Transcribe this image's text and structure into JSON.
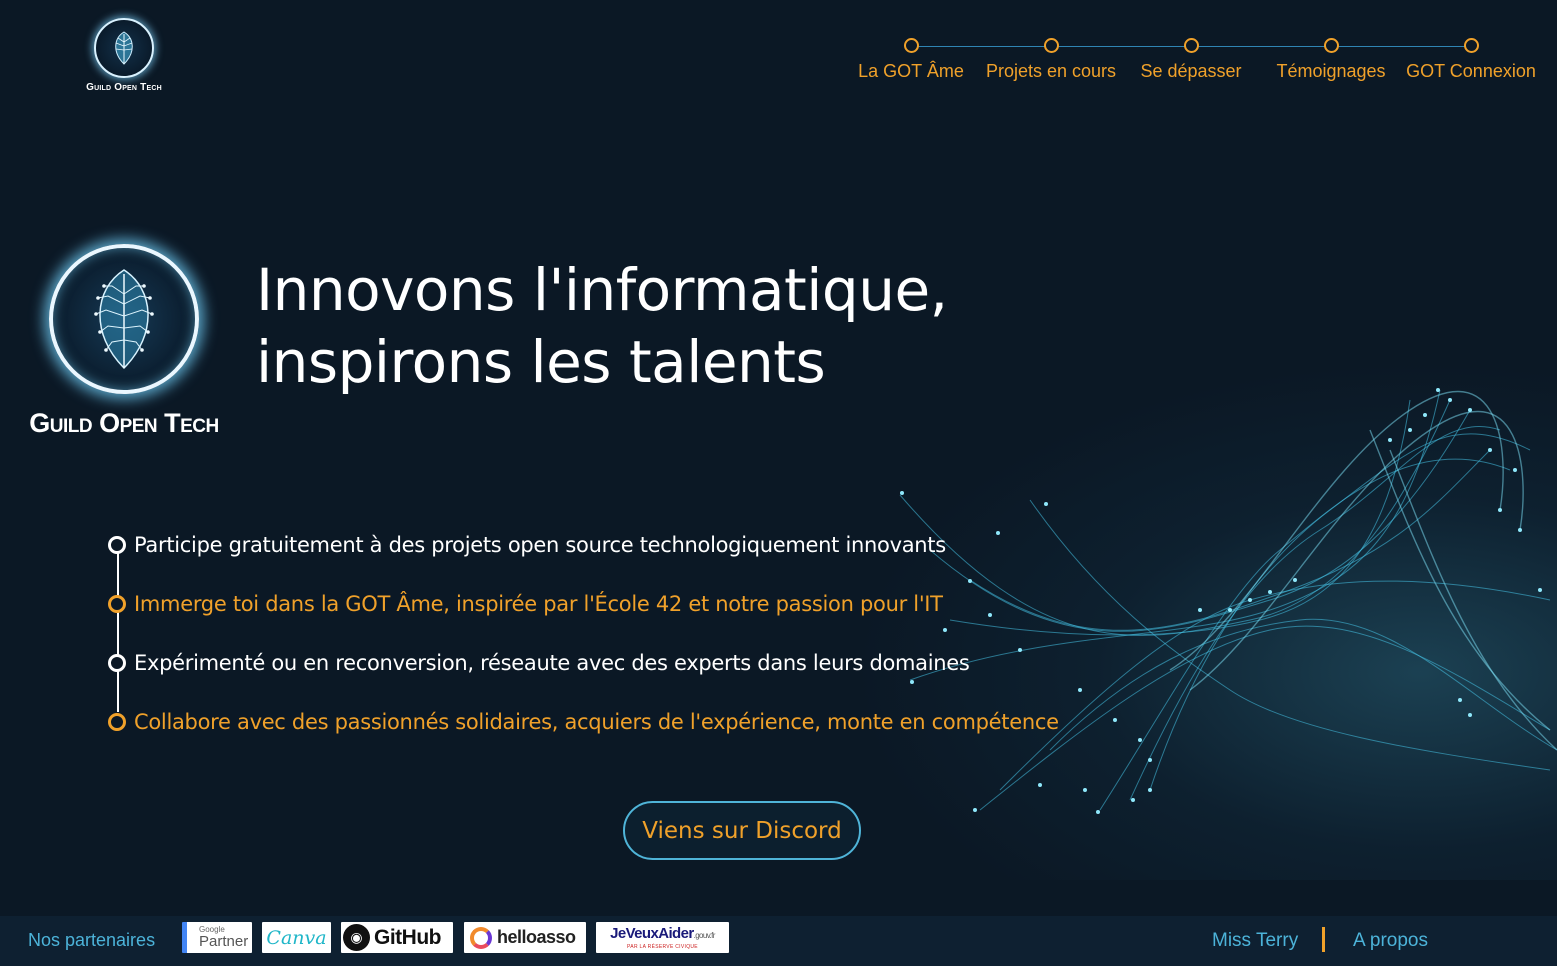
{
  "brand": {
    "name_small": "Guild Open Tech",
    "name_large": "Guild Open Tech"
  },
  "nav": {
    "items": [
      {
        "label": "La GOT Âme"
      },
      {
        "label": "Projets en cours"
      },
      {
        "label": "Se dépasser"
      },
      {
        "label": "Témoignages"
      },
      {
        "label": "GOT Connexion"
      }
    ]
  },
  "hero": {
    "line1": "Innovons l'informatique,",
    "line2": "inspirons les talents"
  },
  "features": [
    {
      "text": "Participe gratuitement à des projets open source technologiquement innovants"
    },
    {
      "text": "Immerge toi dans la GOT Âme, inspirée par l'École 42 et notre passion pour l'IT"
    },
    {
      "text": "Expérimenté ou en reconversion, réseaute avec des experts dans leurs domaines"
    },
    {
      "text": "Collabore avec des passionnés solidaires, acquiers de l'expérience, monte en compétence"
    }
  ],
  "cta": {
    "label": "Viens sur Discord"
  },
  "footer": {
    "partners_label": "Nos partenaires",
    "partners": {
      "google_top": "Google",
      "google_bottom": "Partner",
      "canva": "Canva",
      "github": "GitHub",
      "helloasso": "helloasso",
      "jeveuxaider": "JeVeuxAider",
      "jeveuxaider_suffix": ".gouv.fr",
      "jeveuxaider_tag": "PAR LA RÉSERVE CIVIQUE"
    },
    "link_1": "Miss Terry",
    "link_2": "A propos"
  },
  "colors": {
    "background": "#0b1825",
    "accent_orange": "#f0a12a",
    "accent_cyan": "#4cb3d9"
  },
  "icons": [
    "leaf-circuit-logo-icon",
    "github-octocat-icon",
    "helloasso-ring-icon"
  ]
}
